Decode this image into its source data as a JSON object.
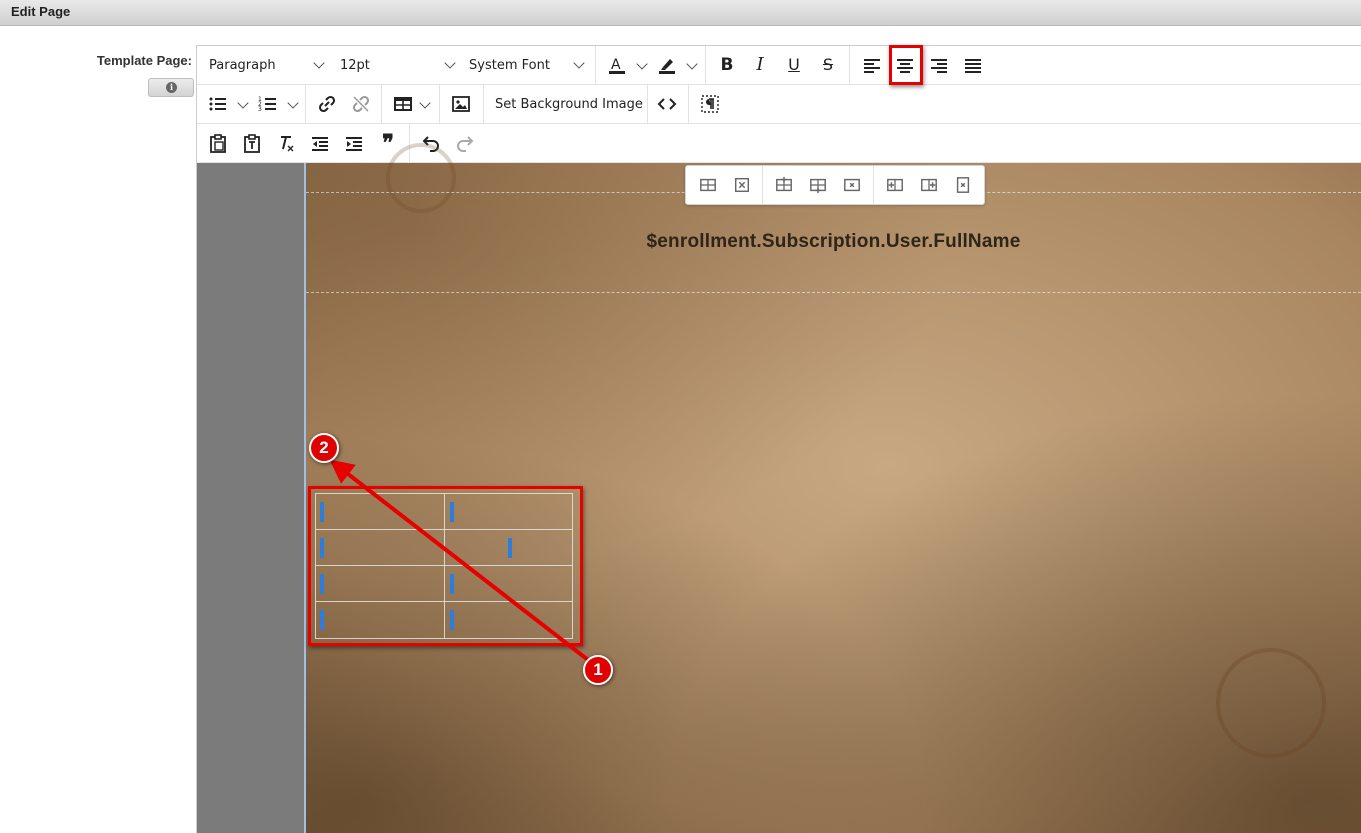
{
  "header": {
    "title": "Edit Page"
  },
  "form": {
    "label": "Template Page:",
    "info_icon": "info-icon"
  },
  "toolbar": {
    "row1": {
      "block_format": "Paragraph",
      "font_size": "12pt",
      "font_family": "System Font",
      "bold": "B",
      "italic": "I",
      "underline": "U",
      "strike": "S",
      "text_color_letter": "A",
      "text_color": "#222222",
      "highlight_color": "#222222"
    },
    "row2": {
      "set_background_label": "Set Background Image"
    },
    "row3": {
      "blockquote_glyph": "❞"
    },
    "active_button": "align-center"
  },
  "document": {
    "header_text": "$enrollment.Subscription.User.FullName",
    "table": {
      "rows": 4,
      "cols": 2
    }
  },
  "annotations": {
    "badges": [
      {
        "label": "1"
      },
      {
        "label": "2"
      }
    ],
    "color": "#e60000"
  }
}
